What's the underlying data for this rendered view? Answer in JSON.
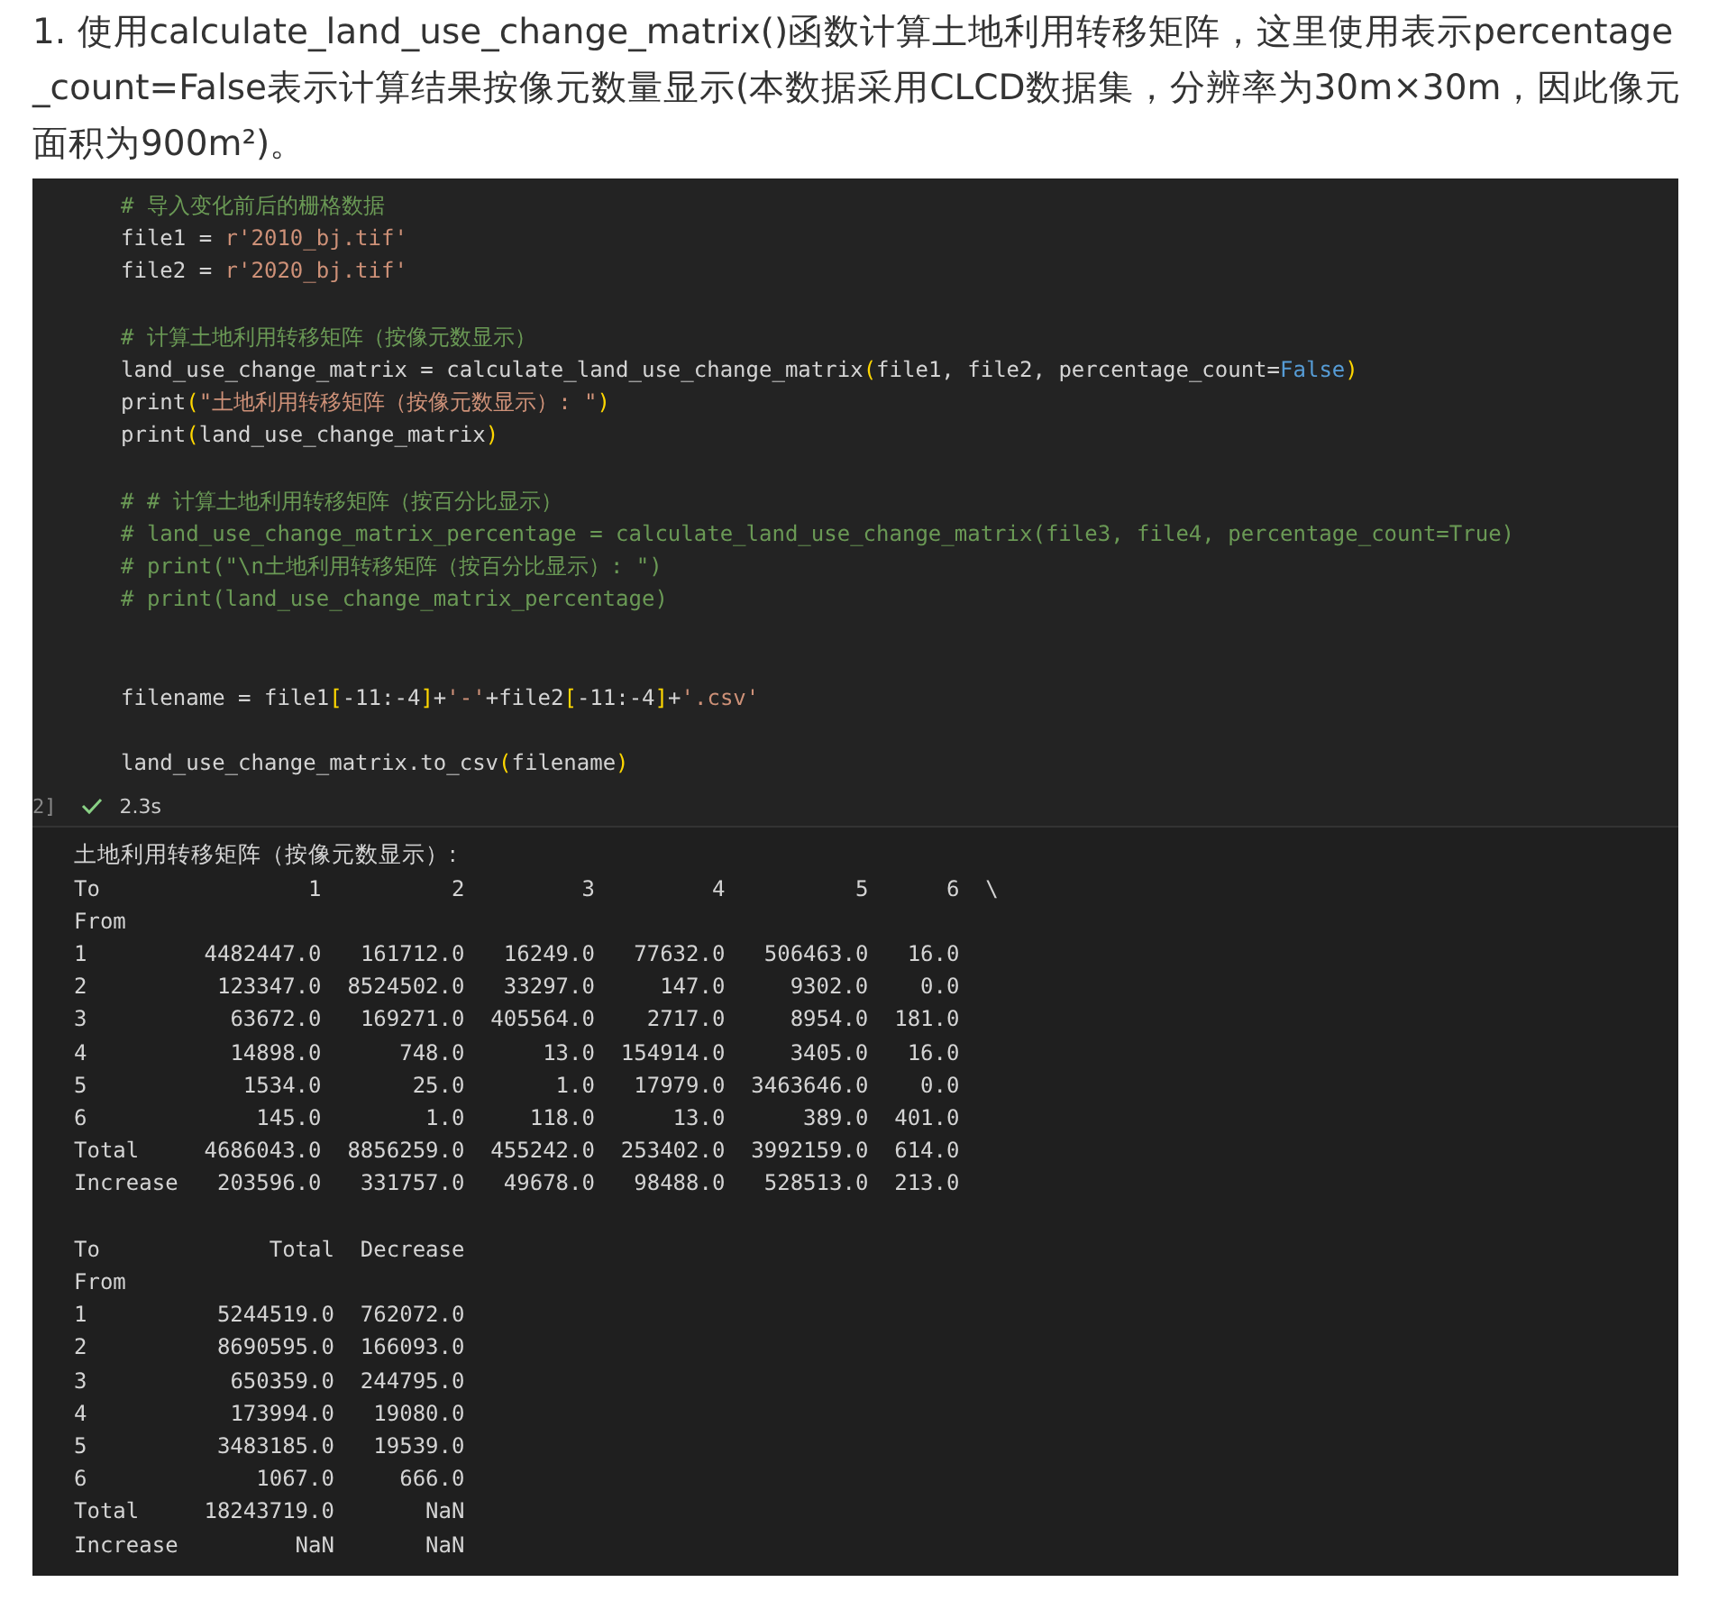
{
  "intro": "1. 使用calculate_land_use_change_matrix()函数计算土地利用转移矩阵，这里使用表示percentage_count=False表示计算结果按像元数量显示(本数据采用CLCD数据集，分辨率为30m×30m，因此像元面积为900m²)。",
  "code_cell": {
    "lines": [
      {
        "kind": "code",
        "tokens": [
          {
            "kind": "comment",
            "text": "# 导入变化前后的栅格数据"
          }
        ]
      },
      {
        "kind": "code",
        "tokens": [
          {
            "kind": "plain",
            "text": "file1 = "
          },
          {
            "kind": "string",
            "text": "r'2010_bj.tif'"
          }
        ]
      },
      {
        "kind": "code",
        "tokens": [
          {
            "kind": "plain",
            "text": "file2 = "
          },
          {
            "kind": "string",
            "text": "r'2020_bj.tif'"
          }
        ]
      },
      {
        "kind": "blank"
      },
      {
        "kind": "code",
        "tokens": [
          {
            "kind": "comment",
            "text": "# 计算土地利用转移矩阵（按像元数显示）"
          }
        ]
      },
      {
        "kind": "code",
        "tokens": [
          {
            "kind": "plain",
            "text": "land_use_change_matrix = calculate_land_use_change_matrix"
          },
          {
            "kind": "bracket",
            "text": "("
          },
          {
            "kind": "plain",
            "text": "file1, file2, percentage_count="
          },
          {
            "kind": "constant",
            "text": "False"
          },
          {
            "kind": "bracket",
            "text": ")"
          }
        ]
      },
      {
        "kind": "code",
        "tokens": [
          {
            "kind": "plain",
            "text": "print"
          },
          {
            "kind": "bracket",
            "text": "("
          },
          {
            "kind": "string",
            "text": "\"土地利用转移矩阵（按像元数显示）: \""
          },
          {
            "kind": "bracket",
            "text": ")"
          }
        ]
      },
      {
        "kind": "code",
        "tokens": [
          {
            "kind": "plain",
            "text": "print"
          },
          {
            "kind": "bracket",
            "text": "("
          },
          {
            "kind": "plain",
            "text": "land_use_change_matrix"
          },
          {
            "kind": "bracket",
            "text": ")"
          }
        ]
      },
      {
        "kind": "blank"
      },
      {
        "kind": "code",
        "tokens": [
          {
            "kind": "comment",
            "text": "# # 计算土地利用转移矩阵（按百分比显示）"
          }
        ]
      },
      {
        "kind": "code",
        "tokens": [
          {
            "kind": "comment",
            "text": "# land_use_change_matrix_percentage = calculate_land_use_change_matrix(file3, file4, percentage_count=True)"
          }
        ]
      },
      {
        "kind": "code",
        "tokens": [
          {
            "kind": "comment",
            "text": "# print(\"\\n土地利用转移矩阵（按百分比显示）: \")"
          }
        ]
      },
      {
        "kind": "code",
        "tokens": [
          {
            "kind": "comment",
            "text": "# print(land_use_change_matrix_percentage)"
          }
        ]
      },
      {
        "kind": "blank"
      },
      {
        "kind": "blank"
      },
      {
        "kind": "code",
        "tokens": [
          {
            "kind": "plain",
            "text": "filename = file1"
          },
          {
            "kind": "bracket",
            "text": "["
          },
          {
            "kind": "plain",
            "text": "-11:-4"
          },
          {
            "kind": "bracket",
            "text": "]"
          },
          {
            "kind": "plain",
            "text": "+"
          },
          {
            "kind": "string",
            "text": "'-'"
          },
          {
            "kind": "plain",
            "text": "+file2"
          },
          {
            "kind": "bracket",
            "text": "["
          },
          {
            "kind": "plain",
            "text": "-11:-4"
          },
          {
            "kind": "bracket",
            "text": "]"
          },
          {
            "kind": "plain",
            "text": "+"
          },
          {
            "kind": "string",
            "text": "'.csv'"
          }
        ]
      },
      {
        "kind": "blank"
      },
      {
        "kind": "code",
        "tokens": [
          {
            "kind": "plain",
            "text": "land_use_change_matrix.to_csv"
          },
          {
            "kind": "bracket",
            "text": "("
          },
          {
            "kind": "plain",
            "text": "filename"
          },
          {
            "kind": "bracket",
            "text": ")"
          }
        ]
      }
    ],
    "execution_count": "2]",
    "succeeded": true,
    "duration": "2.3s"
  },
  "output": {
    "title": "土地利用转移矩阵（按像元数显示）:",
    "tables": [
      {
        "columns_label": "To",
        "index_name": "From",
        "continuation": "\\",
        "columns": [
          "1",
          "2",
          "3",
          "4",
          "5",
          "6"
        ],
        "rows": [
          {
            "label": "1",
            "values": [
              "4482447.0",
              "161712.0",
              "16249.0",
              "77632.0",
              "506463.0",
              "16.0"
            ]
          },
          {
            "label": "2",
            "values": [
              "123347.0",
              "8524502.0",
              "33297.0",
              "147.0",
              "9302.0",
              "0.0"
            ]
          },
          {
            "label": "3",
            "values": [
              "63672.0",
              "169271.0",
              "405564.0",
              "2717.0",
              "8954.0",
              "181.0"
            ]
          },
          {
            "label": "4",
            "values": [
              "14898.0",
              "748.0",
              "13.0",
              "154914.0",
              "3405.0",
              "16.0"
            ]
          },
          {
            "label": "5",
            "values": [
              "1534.0",
              "25.0",
              "1.0",
              "17979.0",
              "3463646.0",
              "0.0"
            ]
          },
          {
            "label": "6",
            "values": [
              "145.0",
              "1.0",
              "118.0",
              "13.0",
              "389.0",
              "401.0"
            ]
          },
          {
            "label": "Total",
            "values": [
              "4686043.0",
              "8856259.0",
              "455242.0",
              "253402.0",
              "3992159.0",
              "614.0"
            ]
          },
          {
            "label": "Increase",
            "values": [
              "203596.0",
              "331757.0",
              "49678.0",
              "98488.0",
              "528513.0",
              "213.0"
            ]
          }
        ]
      },
      {
        "columns_label": "To",
        "index_name": "From",
        "columns": [
          "Total",
          "Decrease"
        ],
        "rows": [
          {
            "label": "1",
            "values": [
              "5244519.0",
              "762072.0"
            ]
          },
          {
            "label": "2",
            "values": [
              "8690595.0",
              "166093.0"
            ]
          },
          {
            "label": "3",
            "values": [
              "650359.0",
              "244795.0"
            ]
          },
          {
            "label": "4",
            "values": [
              "173994.0",
              "19080.0"
            ]
          },
          {
            "label": "5",
            "values": [
              "3483185.0",
              "19539.0"
            ]
          },
          {
            "label": "6",
            "values": [
              "1067.0",
              "666.0"
            ]
          },
          {
            "label": "Total",
            "values": [
              "18243719.0",
              "NaN"
            ]
          },
          {
            "label": "Increase",
            "values": [
              "NaN",
              "NaN"
            ]
          }
        ]
      }
    ]
  }
}
